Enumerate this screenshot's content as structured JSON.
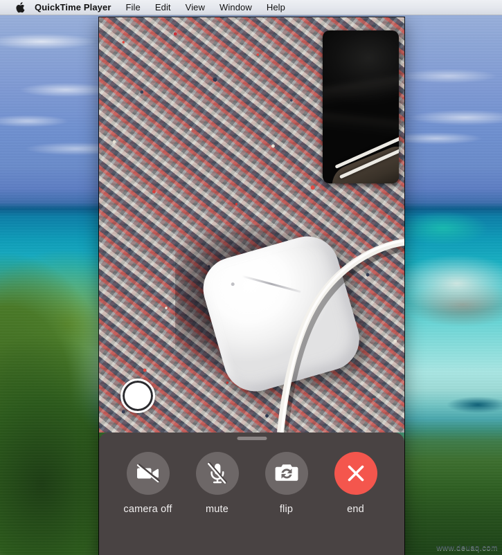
{
  "menubar": {
    "apple_icon": "apple-logo-icon",
    "app_name": "QuickTime Player",
    "items": [
      {
        "label": "File"
      },
      {
        "label": "Edit"
      },
      {
        "label": "View"
      },
      {
        "label": "Window"
      },
      {
        "label": "Help"
      }
    ]
  },
  "mirror_window": {
    "main_camera": {
      "description": "rear camera view: white AirPods charging case on red, navy and white speckled carpet with a white charging cable"
    },
    "pip": {
      "description": "front camera view: dark black fabric with white striped shoe at bottom"
    },
    "shutter": {
      "icon": "shutter-capture-icon",
      "label": ""
    }
  },
  "control_panel": {
    "drag_handle": "drag-handle",
    "buttons": [
      {
        "label": "camera off",
        "icon": "video-camera-off-icon",
        "style": "neutral"
      },
      {
        "label": "mute",
        "icon": "microphone-off-icon",
        "style": "neutral"
      },
      {
        "label": "flip",
        "icon": "camera-flip-icon",
        "style": "neutral"
      },
      {
        "label": "end",
        "icon": "close-x-icon",
        "style": "danger"
      }
    ]
  },
  "watermark": {
    "text": "www.deuaq.com"
  },
  "colors": {
    "menubar_bg": "#e6e9ef",
    "panel_bg": "#494343",
    "bubble_bg": "#6d6767",
    "end_button": "#f4564d",
    "caption_text": "#f2f0f0"
  }
}
